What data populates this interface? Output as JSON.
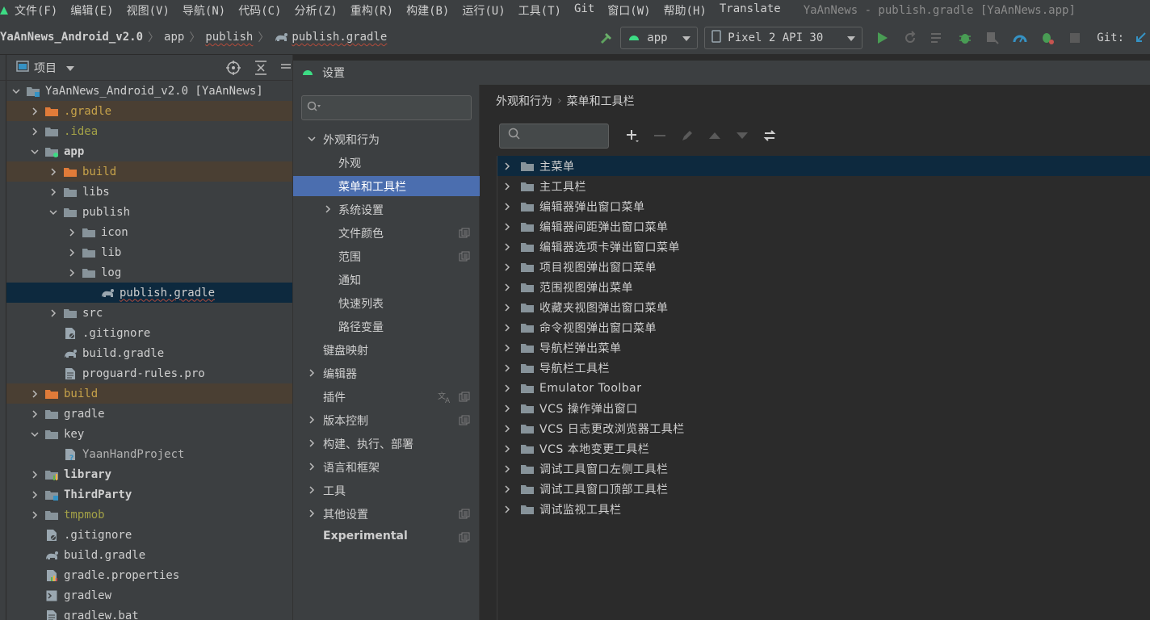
{
  "menubar": {
    "items": [
      "文件(F)",
      "编辑(E)",
      "视图(V)",
      "导航(N)",
      "代码(C)",
      "分析(Z)",
      "重构(R)",
      "构建(B)",
      "运行(U)",
      "工具(T)",
      "Git",
      "窗口(W)",
      "帮助(H)",
      "Translate"
    ],
    "window_title": "YaAnNews - publish.gradle [YaAnNews.app]"
  },
  "navbar": {
    "crumbs": [
      "YaAnNews_Android_v2.0",
      "app",
      "publish",
      "publish.gradle"
    ],
    "run_config": "app",
    "device": "Pixel 2 API 30",
    "git_label": "Git:"
  },
  "project_panel": {
    "title": "项目",
    "tree": [
      {
        "label": "YaAnNews_Android_v2.0 [YaAnNews]",
        "depth": 0,
        "chev": "down",
        "icon": "module-folder"
      },
      {
        "label": ".gradle",
        "depth": 1,
        "chev": "right",
        "icon": "orange-folder",
        "state": "excluded"
      },
      {
        "label": ".idea",
        "depth": 1,
        "chev": "right",
        "icon": "folder",
        "state": "olive"
      },
      {
        "label": "app",
        "depth": 1,
        "chev": "down",
        "icon": "app-folder",
        "state": "bold"
      },
      {
        "label": "build",
        "depth": 2,
        "chev": "right",
        "icon": "orange-folder",
        "state": "excluded"
      },
      {
        "label": "libs",
        "depth": 2,
        "chev": "right",
        "icon": "folder"
      },
      {
        "label": "publish",
        "depth": 2,
        "chev": "down",
        "icon": "folder"
      },
      {
        "label": "icon",
        "depth": 3,
        "chev": "right",
        "icon": "folder"
      },
      {
        "label": "lib",
        "depth": 3,
        "chev": "right",
        "icon": "folder"
      },
      {
        "label": "log",
        "depth": 3,
        "chev": "right",
        "icon": "folder"
      },
      {
        "label": "publish.gradle",
        "depth": 4,
        "chev": "none",
        "icon": "gradle",
        "state": "selected"
      },
      {
        "label": "src",
        "depth": 2,
        "chev": "right",
        "icon": "folder"
      },
      {
        "label": ".gitignore",
        "depth": 2,
        "chev": "none",
        "icon": "file-ignore"
      },
      {
        "label": "build.gradle",
        "depth": 2,
        "chev": "none",
        "icon": "gradle"
      },
      {
        "label": "proguard-rules.pro",
        "depth": 2,
        "chev": "none",
        "icon": "file"
      },
      {
        "label": "build",
        "depth": 1,
        "chev": "right",
        "icon": "orange-folder",
        "state": "excluded"
      },
      {
        "label": "gradle",
        "depth": 1,
        "chev": "right",
        "icon": "folder"
      },
      {
        "label": "key",
        "depth": 1,
        "chev": "down",
        "icon": "folder"
      },
      {
        "label": "YaanHandProject",
        "depth": 2,
        "chev": "none",
        "icon": "file-unknown",
        "state": "muted"
      },
      {
        "label": "library",
        "depth": 1,
        "chev": "right",
        "icon": "lib-folder",
        "state": "bold"
      },
      {
        "label": "ThirdParty",
        "depth": 1,
        "chev": "right",
        "icon": "module-folder",
        "state": "bold"
      },
      {
        "label": "tmpmob",
        "depth": 1,
        "chev": "right",
        "icon": "folder",
        "state": "olive"
      },
      {
        "label": ".gitignore",
        "depth": 1,
        "chev": "none",
        "icon": "file-ignore"
      },
      {
        "label": "build.gradle",
        "depth": 1,
        "chev": "none",
        "icon": "gradle"
      },
      {
        "label": "gradle.properties",
        "depth": 1,
        "chev": "none",
        "icon": "file-chart"
      },
      {
        "label": "gradlew",
        "depth": 1,
        "chev": "none",
        "icon": "terminal"
      },
      {
        "label": "gradlew.bat",
        "depth": 1,
        "chev": "none",
        "icon": "file"
      }
    ]
  },
  "settings": {
    "title": "设置",
    "nav": [
      {
        "label": "外观和行为",
        "level": 0,
        "chev": "down"
      },
      {
        "label": "外观",
        "level": 1,
        "chev": "none"
      },
      {
        "label": "菜单和工具栏",
        "level": 1,
        "chev": "none",
        "selected": true
      },
      {
        "label": "系统设置",
        "level": 1,
        "chev": "right"
      },
      {
        "label": "文件颜色",
        "level": 1,
        "chev": "none",
        "badge": true
      },
      {
        "label": "范围",
        "level": 1,
        "chev": "none",
        "badge": true
      },
      {
        "label": "通知",
        "level": 1,
        "chev": "none"
      },
      {
        "label": "快速列表",
        "level": 1,
        "chev": "none"
      },
      {
        "label": "路径变量",
        "level": 1,
        "chev": "none"
      },
      {
        "label": "键盘映射",
        "level": 0,
        "chev": "none"
      },
      {
        "label": "编辑器",
        "level": 0,
        "chev": "right"
      },
      {
        "label": "插件",
        "level": 0,
        "chev": "none",
        "badge": true,
        "translate": true
      },
      {
        "label": "版本控制",
        "level": 0,
        "chev": "right",
        "badge": true
      },
      {
        "label": "构建、执行、部署",
        "level": 0,
        "chev": "right"
      },
      {
        "label": "语言和框架",
        "level": 0,
        "chev": "right"
      },
      {
        "label": "工具",
        "level": 0,
        "chev": "right"
      },
      {
        "label": "其他设置",
        "level": 0,
        "chev": "right",
        "badge": true
      },
      {
        "label": "Experimental",
        "level": 0,
        "chev": "none",
        "badge": true,
        "bold": true
      }
    ],
    "breadcrumb": [
      "外观和行为",
      "菜单和工具栏"
    ],
    "menus": [
      "主菜单",
      "主工具栏",
      "编辑器弹出窗口菜单",
      "编辑器间距弹出窗口菜单",
      "编辑器选项卡弹出窗口菜单",
      "项目视图弹出窗口菜单",
      "范围视图弹出菜单",
      "收藏夹视图弹出窗口菜单",
      "命令视图弹出窗口菜单",
      "导航栏弹出菜单",
      "导航栏工具栏",
      "Emulator Toolbar",
      "VCS 操作弹出窗口",
      "VCS 日志更改浏览器工具栏",
      "VCS 本地变更工具栏",
      "调试工具窗口左侧工具栏",
      "调试工具窗口顶部工具栏",
      "调试监视工具栏"
    ]
  },
  "colors": {
    "accent_selected": "#4b6eaf",
    "tree_selected": "#0d293e",
    "excluded_bg": "#4a3f33",
    "run_green": "#499c54"
  }
}
